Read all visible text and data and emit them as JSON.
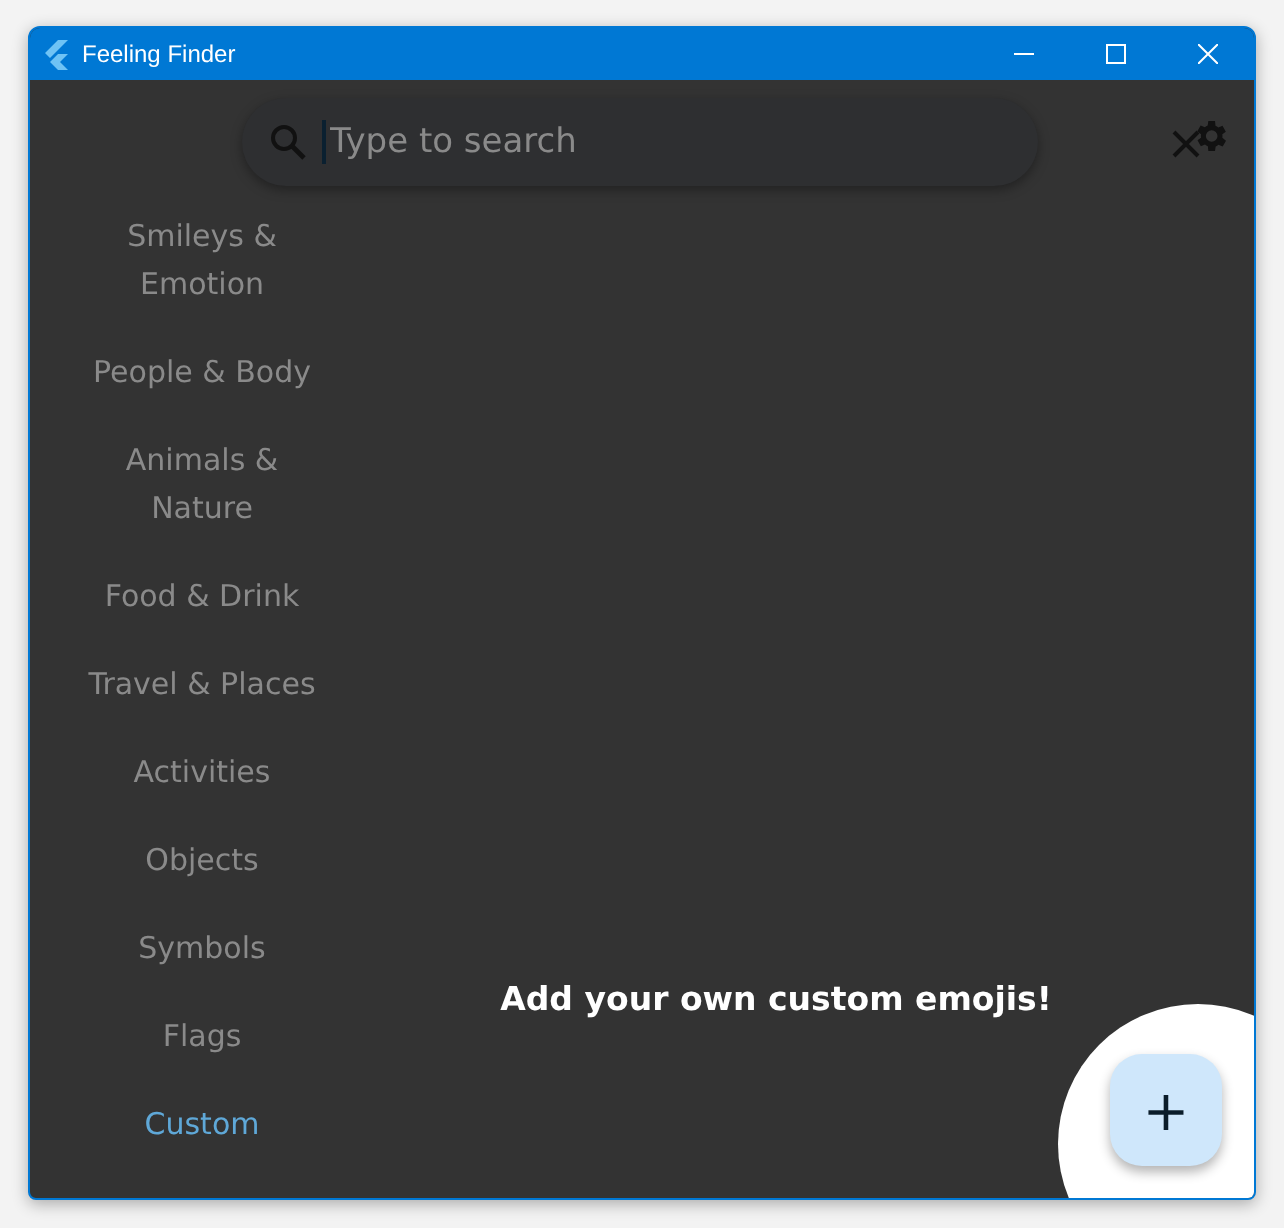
{
  "window": {
    "title": "Feeling Finder"
  },
  "search": {
    "placeholder": "Type to search"
  },
  "sidebar": {
    "items": [
      {
        "label": "Smileys & Emotion",
        "selected": false
      },
      {
        "label": "People & Body",
        "selected": false
      },
      {
        "label": "Animals & Nature",
        "selected": false
      },
      {
        "label": "Food & Drink",
        "selected": false
      },
      {
        "label": "Travel & Places",
        "selected": false
      },
      {
        "label": "Activities",
        "selected": false
      },
      {
        "label": "Objects",
        "selected": false
      },
      {
        "label": "Symbols",
        "selected": false
      },
      {
        "label": "Flags",
        "selected": false
      },
      {
        "label": "Custom",
        "selected": true
      }
    ]
  },
  "hint": "Add your own custom emojis!",
  "fab": {
    "label": "+"
  }
}
